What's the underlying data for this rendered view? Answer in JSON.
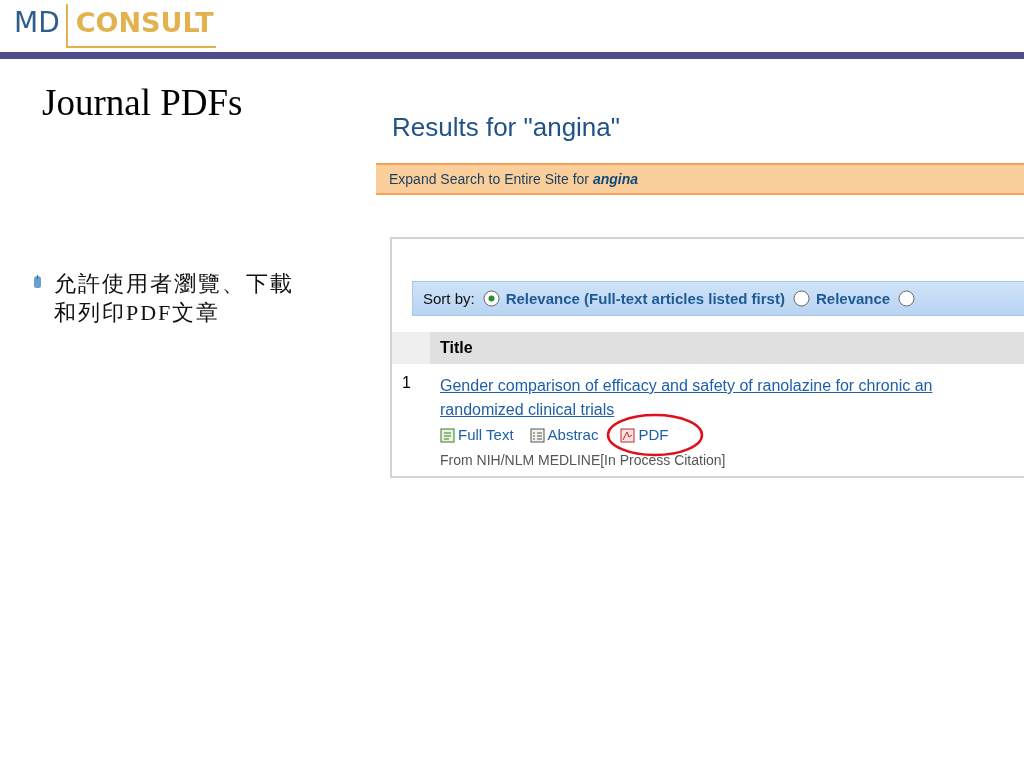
{
  "logo": {
    "first": "MD",
    "second": "CONSULT"
  },
  "slide": {
    "title": "Journal PDFs",
    "bullets": [
      "允許使用者瀏覽、下載和列印PDF文章"
    ]
  },
  "screenshot": {
    "heading": "Results for \"angina\"",
    "expand_bar": {
      "text": "Expand Search to Entire Site for **angina**"
    },
    "sort": {
      "label": "Sort by:",
      "options": [
        {
          "label": "Relevance (Full-text articles listed first)",
          "selected": true
        },
        {
          "label": "Relevance",
          "selected": false
        },
        {
          "selected": false
        }
      ]
    },
    "table": {
      "columns": [
        "Title"
      ],
      "rows": [
        {
          "number": "1",
          "title": "Gender comparison of efficacy and safety of ranolazine for chronic an",
          "title_line2": "randomized clinical trials",
          "links": [
            {
              "kind": "fulltext",
              "label": "Full Text"
            },
            {
              "kind": "abstract",
              "label": "Abstrac"
            },
            {
              "kind": "pdf",
              "label": "PDF",
              "circled": true
            }
          ],
          "source": "From NIH/NLM MEDLINE[In Process Citation]"
        }
      ]
    }
  }
}
